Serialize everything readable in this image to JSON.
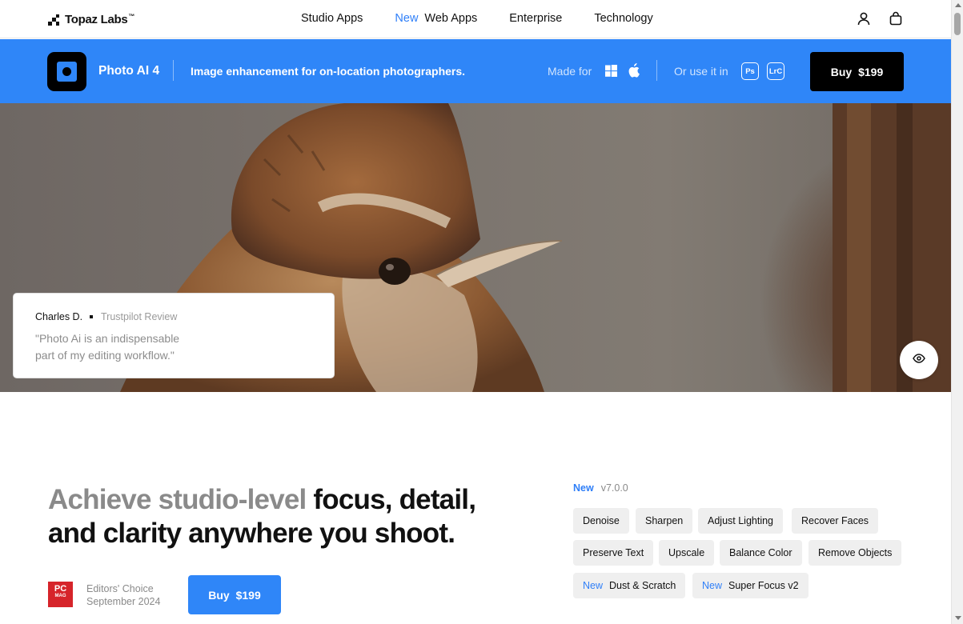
{
  "brand": {
    "name": "Topaz Labs",
    "trademark": "™"
  },
  "nav": {
    "links": [
      "Studio Apps",
      "Web Apps",
      "Enterprise",
      "Technology"
    ],
    "new_badge": "New",
    "icons": [
      "account-icon",
      "cart-icon"
    ]
  },
  "product": {
    "name": "Photo AI 4",
    "tagline": "Image enhancement for on-location photographers.",
    "made_for_label": "Made for",
    "platforms": [
      "windows-icon",
      "apple-icon"
    ],
    "or_use_label": "Or use it in",
    "plugins": [
      "Ps",
      "LrC"
    ],
    "buy_label": "Buy $199"
  },
  "hero": {
    "image": "wren bird close-up photo",
    "review": {
      "author": "Charles D.",
      "source": "Trustpilot Review",
      "quote": "\"Photo Ai is an indispensable part of my editing workflow.\""
    },
    "compare_icon": "eye-icon"
  },
  "main": {
    "headline_muted": "Achieve studio-level",
    "headline_rest": "focus, detail, and clarity anywhere you shoot.",
    "award": {
      "logo_top": "PC",
      "logo_bottom": "MAG",
      "line1": "Editors' Choice",
      "line2": "September 2024"
    },
    "buy_label": "Buy $199",
    "version_new": "New",
    "version": "v7.0.0",
    "features": [
      "Denoise",
      "Sharpen",
      "Adjust Lighting",
      "Recover Faces",
      "Preserve Text",
      "Upscale",
      "Balance Color",
      "Remove Objects"
    ],
    "new_features": [
      "Dust & Scratch",
      "Super Focus v2"
    ],
    "new_badge": "New"
  },
  "colors": {
    "accent": "#2f86f8",
    "new_text": "#2f7ff8",
    "dark": "#000000",
    "chip": "#efefef"
  }
}
